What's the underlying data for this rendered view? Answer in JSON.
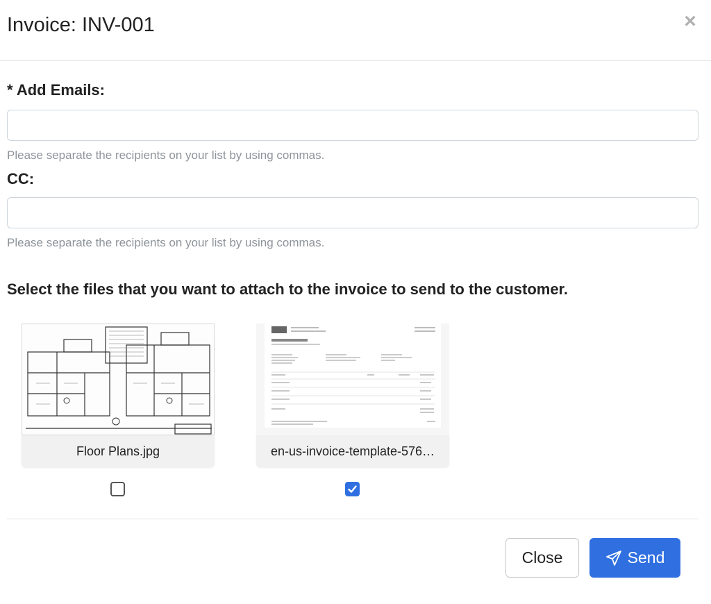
{
  "modal": {
    "title": "Invoice: INV-001",
    "close_icon": "×"
  },
  "emails": {
    "label": "* Add Emails:",
    "value": "",
    "help": "Please separate the recipients on your list by using commas."
  },
  "cc": {
    "label": "CC:",
    "value": "",
    "help": "Please separate the recipients on your list by using commas."
  },
  "attachments": {
    "heading": "Select the files that you want to attach to the invoice to send to the customer.",
    "files": [
      {
        "name": "Floor Plans.jpg",
        "thumbnail": "floor-plan-drawing",
        "checked": false
      },
      {
        "name": "en-us-invoice-template-576…",
        "thumbnail": "invoice-document",
        "checked": true
      }
    ]
  },
  "footer": {
    "close_label": "Close",
    "send_label": "Send",
    "send_icon": "paper-plane-icon"
  },
  "colors": {
    "primary": "#2f6fe0",
    "muted_text": "#8e949a",
    "border": "#ced4da"
  }
}
